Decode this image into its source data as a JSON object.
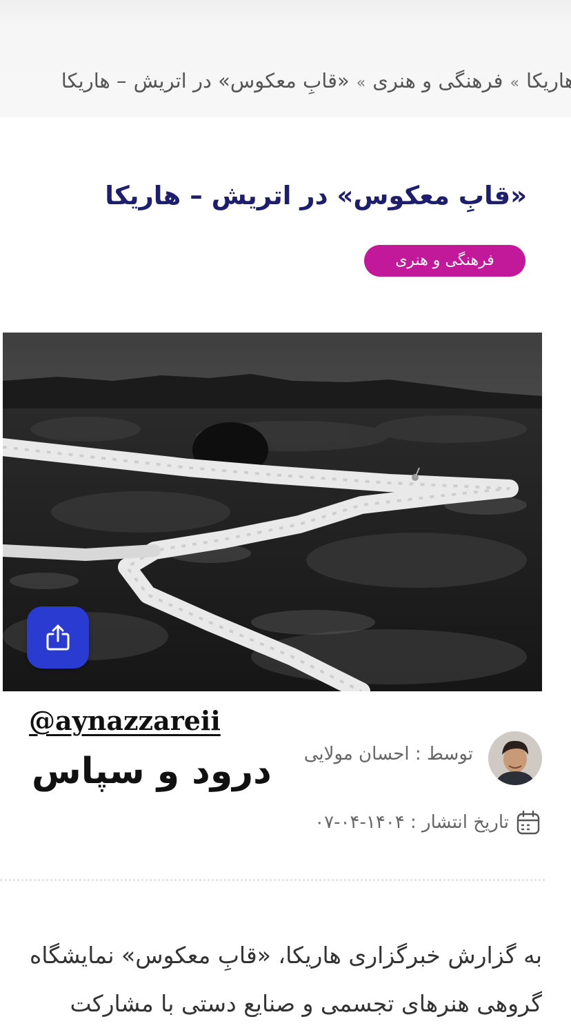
{
  "breadcrumb": {
    "items": [
      "هاریکا",
      "فرهنگی و هنری",
      "«قابِ معکوس» در اتریش"
    ],
    "separator": "»",
    "current_suffix": "–  هاریکا"
  },
  "article": {
    "title": "«قابِ معکوس» در اتریش  –  هاریکا",
    "category": "فرهنگی و هنری",
    "author_line": "توسط : احسان مولایی",
    "date_line": "تاریخ انتشار : ۱۴۰۴-۰۴-۰۷",
    "body_lines": [
      "به گزارش خبرگزاری هاریکا، «قابِ معکوس» نمایشگاه",
      "گروهی هنرهای تجسمی و صنایع دستی با مشارکت"
    ]
  },
  "overlay": {
    "handle": "@aynazzareii",
    "greeting": "درود و سپاس"
  },
  "icons": {
    "share": "share-icon",
    "calendar": "calendar-icon",
    "avatar": "author-avatar"
  },
  "colors": {
    "title": "#1d1f6e",
    "badge": "#c2199a",
    "share_button": "#2a3bd1"
  }
}
